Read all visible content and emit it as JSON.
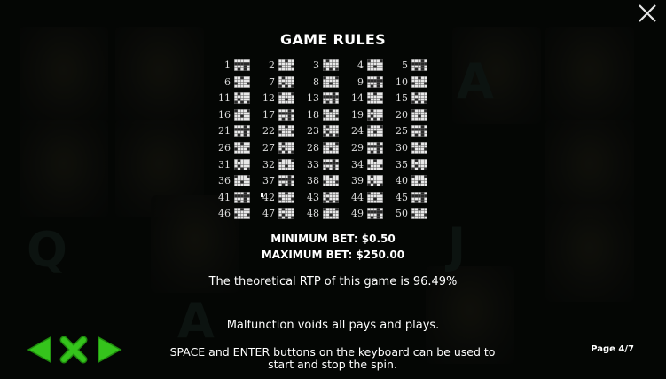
{
  "dialog": {
    "title": "GAME RULES",
    "min_bet": "MINIMUM BET: $0.50",
    "max_bet": "MAXIMUM BET: $250.00",
    "rtp_text": "The theoretical RTP of this game is 96.49%",
    "malfunction_text": "Malfunction voids all pays and plays.",
    "keyboard_text": "SPACE and ENTER buttons on the keyboard can be used to start and stop the spin.",
    "page_indicator": "Page 4/7"
  },
  "paylines": {
    "numbers": [
      "1",
      "2",
      "3",
      "4",
      "5",
      "6",
      "7",
      "8",
      "9",
      "10",
      "11",
      "12",
      "13",
      "14",
      "15",
      "16",
      "17",
      "18",
      "19",
      "20",
      "21",
      "22",
      "23",
      "24",
      "25",
      "26",
      "27",
      "28",
      "29",
      "30",
      "31",
      "32",
      "33",
      "34",
      "35",
      "36",
      "37",
      "38",
      "39",
      "40",
      "41",
      "42",
      "43",
      "44",
      "45",
      "46",
      "47",
      "48",
      "49",
      "50"
    ]
  },
  "background_letters": [
    "Q",
    "A",
    "J",
    "A"
  ],
  "colors": {
    "nav_green": "#35c41c",
    "nav_green_dark": "#1f8a0e",
    "text": "#ffffff"
  },
  "icons": {
    "close": "close-icon",
    "prev": "arrow-left-icon",
    "exit": "x-icon",
    "next": "arrow-right-icon"
  }
}
